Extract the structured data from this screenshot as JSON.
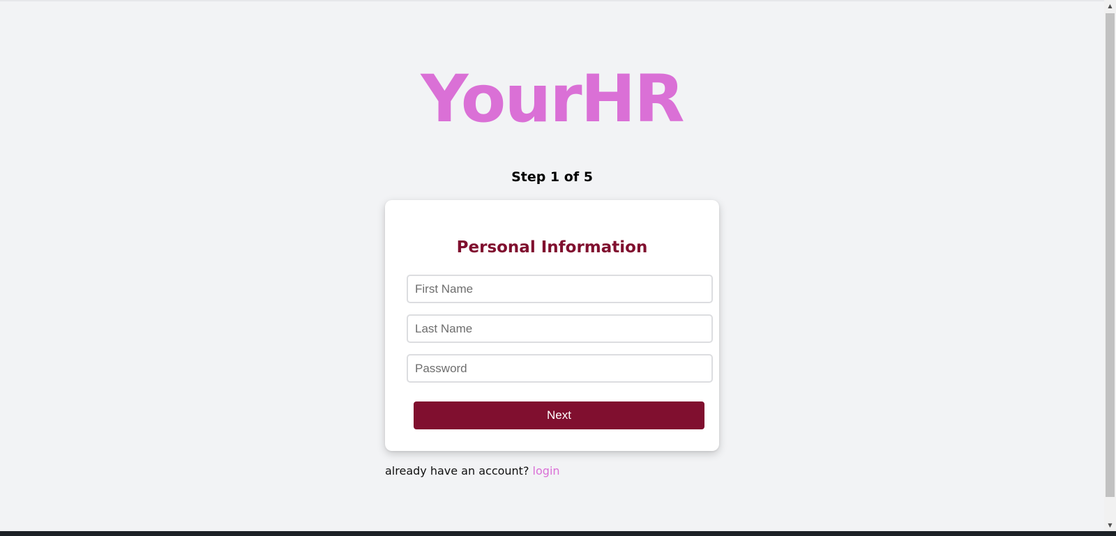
{
  "brand": {
    "name": "YourHR",
    "color": "#da70d6"
  },
  "progress": {
    "label": "Step 1 of 5",
    "current_step": 1,
    "total_steps": 5
  },
  "form": {
    "title": "Personal Information",
    "title_color": "#800f2f",
    "fields": {
      "first_name": {
        "value": "",
        "placeholder": "First Name"
      },
      "last_name": {
        "value": "",
        "placeholder": "Last Name"
      },
      "password": {
        "value": "",
        "placeholder": "Password"
      }
    },
    "next_label": "Next",
    "button_color": "#800f2f"
  },
  "footer": {
    "prompt": "already have an account?",
    "login_label": "login",
    "link_color": "#da70d6"
  },
  "icons": {
    "scroll_up": "scroll-up-arrow-icon",
    "scroll_down": "scroll-down-arrow-icon"
  }
}
